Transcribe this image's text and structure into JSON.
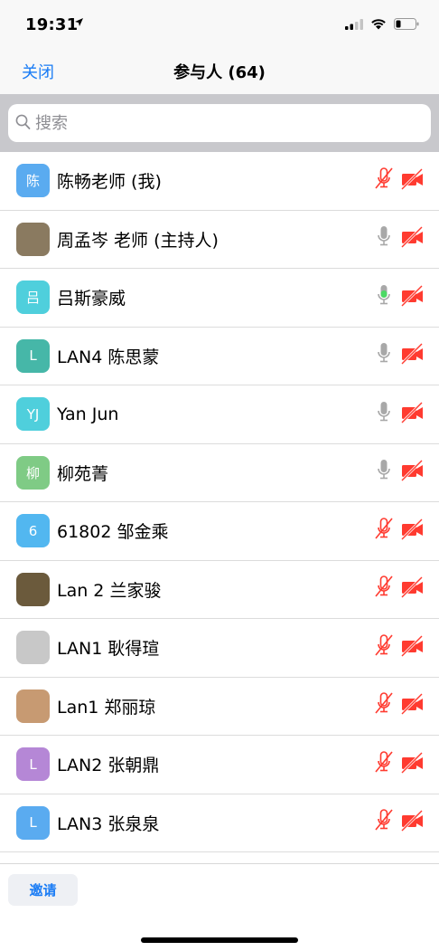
{
  "status_bar": {
    "time": "19:31"
  },
  "nav": {
    "close_label": "关闭",
    "title": "参与人 (64)"
  },
  "search": {
    "placeholder": "搜索"
  },
  "participants": [
    {
      "name": "陈畅老师 (我)",
      "avatar_text": "陈",
      "avatar_color": "#5aabf0",
      "mic": "muted",
      "camera": "off"
    },
    {
      "name": "周孟岑 老师 (主持人)",
      "avatar_text": "",
      "avatar_color": "#8a7a60",
      "mic": "unmuted",
      "camera": "off"
    },
    {
      "name": "吕斯豪威",
      "avatar_text": "吕",
      "avatar_color": "#4fcfdc",
      "mic": "active",
      "camera": "off"
    },
    {
      "name": "LAN4 陈思蒙",
      "avatar_text": "L",
      "avatar_color": "#46b7a8",
      "mic": "unmuted",
      "camera": "off"
    },
    {
      "name": "Yan Jun",
      "avatar_text": "YJ",
      "avatar_color": "#4fcfdc",
      "mic": "unmuted",
      "camera": "off"
    },
    {
      "name": "柳苑菁",
      "avatar_text": "柳",
      "avatar_color": "#7fcb85",
      "mic": "unmuted",
      "camera": "off"
    },
    {
      "name": "61802 邹金乘",
      "avatar_text": "6",
      "avatar_color": "#52b7f0",
      "mic": "muted",
      "camera": "off"
    },
    {
      "name": "Lan 2 兰家骏",
      "avatar_text": "",
      "avatar_color": "#6b5a3c",
      "mic": "muted",
      "camera": "off"
    },
    {
      "name": "LAN1 耿得瑄",
      "avatar_text": "",
      "avatar_color": "#c8c8c8",
      "mic": "muted",
      "camera": "off"
    },
    {
      "name": "Lan1 郑丽琼",
      "avatar_text": "",
      "avatar_color": "#c79a72",
      "mic": "muted",
      "camera": "off"
    },
    {
      "name": "LAN2 张朝鼎",
      "avatar_text": "L",
      "avatar_color": "#b587d6",
      "mic": "muted",
      "camera": "off"
    },
    {
      "name": "LAN3 张泉泉",
      "avatar_text": "L",
      "avatar_color": "#5aabf0",
      "mic": "muted",
      "camera": "off"
    }
  ],
  "footer": {
    "invite_label": "邀请"
  },
  "colors": {
    "accent": "#1a7cf5",
    "muted_red": "#ff3b30",
    "mic_grey": "#a8a8a8",
    "mic_active": "#4cd964"
  }
}
